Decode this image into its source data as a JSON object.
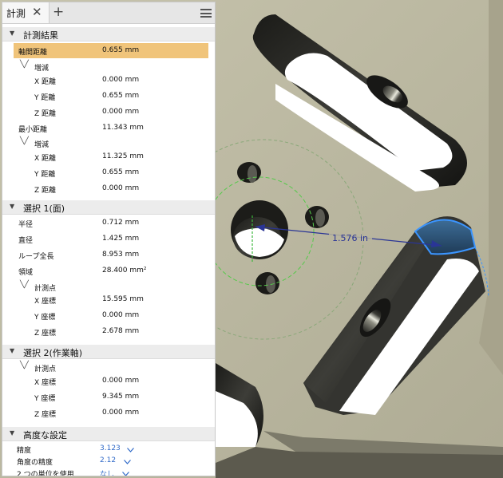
{
  "colors": {
    "accent": "#2f69c8",
    "highlight": "#f0c47a",
    "measure_line": "#2a3596"
  },
  "tab": {
    "label": "計測",
    "close_icon": "close-icon",
    "add_icon": "plus-icon",
    "menu_icon": "menu-icon"
  },
  "sections": {
    "results": {
      "title": "計測結果"
    },
    "selection1": {
      "title": "選択 1(面)"
    },
    "selection2": {
      "title": "選択 2(作業軸)"
    },
    "advanced": {
      "title": "高度な設定"
    }
  },
  "results": {
    "axis_distance": {
      "label": "軸間距離",
      "value": "0.655 mm"
    },
    "delta1": {
      "label": "増減"
    },
    "dx1": {
      "label": "X 距離",
      "value": "0.000 mm"
    },
    "dy1": {
      "label": "Y 距離",
      "value": "0.655 mm"
    },
    "dz1": {
      "label": "Z 距離",
      "value": "0.000 mm"
    },
    "min_distance": {
      "label": "最小距離",
      "value": "11.343 mm"
    },
    "delta2": {
      "label": "増減"
    },
    "dx2": {
      "label": "X 距離",
      "value": "11.325 mm"
    },
    "dy2": {
      "label": "Y 距離",
      "value": "0.655 mm"
    },
    "dz2": {
      "label": "Z 距離",
      "value": "0.000 mm"
    }
  },
  "sel1": {
    "radius": {
      "label": "半径",
      "value": "0.712 mm"
    },
    "diameter": {
      "label": "直径",
      "value": "1.425 mm"
    },
    "loop": {
      "label": "ループ全長",
      "value": "8.953 mm"
    },
    "area": {
      "label": "領域",
      "value": "28.400 mm²"
    },
    "point": {
      "label": "計測点"
    },
    "x": {
      "label": "X 座標",
      "value": "15.595 mm"
    },
    "y": {
      "label": "Y 座標",
      "value": "0.000 mm"
    },
    "z": {
      "label": "Z 座標",
      "value": "2.678 mm"
    }
  },
  "sel2": {
    "point": {
      "label": "計測点"
    },
    "x": {
      "label": "X 座標",
      "value": "0.000 mm"
    },
    "y": {
      "label": "Y 座標",
      "value": "9.345 mm"
    },
    "z": {
      "label": "Z 座標",
      "value": "0.000 mm"
    }
  },
  "advanced": {
    "precision": {
      "label": "精度",
      "value": "3.123"
    },
    "angle_precision": {
      "label": "角度の精度",
      "value": "2.12"
    },
    "dual_units": {
      "label": "2 つの単位を使用",
      "value": "なし"
    }
  },
  "viewport": {
    "measurement_label": "1.576 in"
  }
}
